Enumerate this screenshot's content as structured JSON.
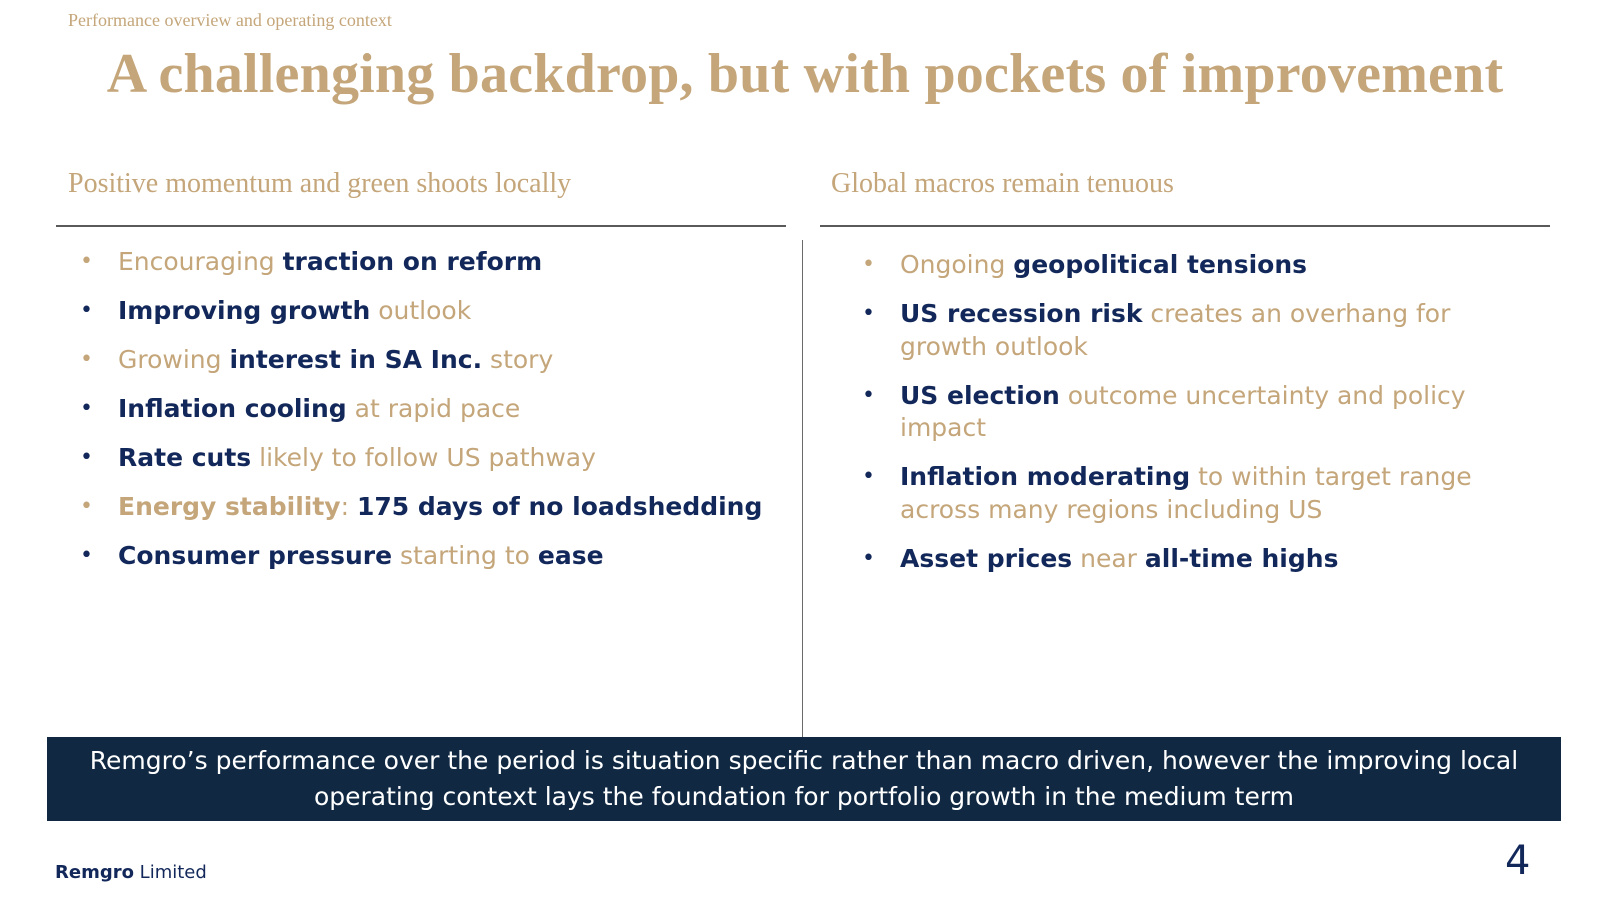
{
  "header": {
    "section_tag": "Performance overview and operating context",
    "title": "A challenging backdrop, but with pockets of improvement"
  },
  "colors": {
    "gold": "#C4A67A",
    "navy": "#13285A",
    "banner_bg": "#102842",
    "banner_text": "#FFFFFF"
  },
  "left_column": {
    "heading": "Positive momentum and green shoots locally",
    "items": [
      {
        "bullet_color": "gold",
        "segments": [
          {
            "text": "Encouraging ",
            "style": "light-gold"
          },
          {
            "text": "traction on reform",
            "style": "bold-navy"
          }
        ]
      },
      {
        "bullet_color": "navy",
        "segments": [
          {
            "text": "Improving growth",
            "style": "bold-navy"
          },
          {
            "text": " outlook",
            "style": "light-gold"
          }
        ]
      },
      {
        "bullet_color": "gold",
        "segments": [
          {
            "text": "Growing ",
            "style": "light-gold"
          },
          {
            "text": "interest in SA Inc.",
            "style": "bold-navy"
          },
          {
            "text": " story",
            "style": "light-gold"
          }
        ]
      },
      {
        "bullet_color": "navy",
        "segments": [
          {
            "text": "Inflation cooling",
            "style": "bold-navy"
          },
          {
            "text": " at rapid pace",
            "style": "light-gold"
          }
        ]
      },
      {
        "bullet_color": "navy",
        "segments": [
          {
            "text": "Rate cuts",
            "style": "bold-navy"
          },
          {
            "text": " likely to follow US pathway",
            "style": "light-gold"
          }
        ]
      },
      {
        "bullet_color": "gold",
        "segments": [
          {
            "text": "Energy stability",
            "style": "bold-gold"
          },
          {
            "text": ": ",
            "style": "light-gold"
          },
          {
            "text": "175 days of no loadshedding",
            "style": "bold-navy"
          }
        ]
      },
      {
        "bullet_color": "navy",
        "segments": [
          {
            "text": "Consumer pressure",
            "style": "bold-navy"
          },
          {
            "text": " starting to ",
            "style": "light-gold"
          },
          {
            "text": "ease",
            "style": "bold-navy"
          }
        ]
      }
    ]
  },
  "right_column": {
    "heading": "Global macros remain tenuous",
    "items": [
      {
        "bullet_color": "gold",
        "segments": [
          {
            "text": "Ongoing ",
            "style": "light-gold"
          },
          {
            "text": "geopolitical tensions",
            "style": "bold-navy"
          }
        ]
      },
      {
        "bullet_color": "navy",
        "segments": [
          {
            "text": "US recession risk",
            "style": "bold-navy"
          },
          {
            "text": " creates an overhang for growth outlook",
            "style": "light-gold"
          }
        ]
      },
      {
        "bullet_color": "navy",
        "segments": [
          {
            "text": "US election",
            "style": "bold-navy"
          },
          {
            "text": " outcome uncertainty and policy impact",
            "style": "light-gold"
          }
        ]
      },
      {
        "bullet_color": "navy",
        "segments": [
          {
            "text": "Inflation moderating",
            "style": "bold-navy"
          },
          {
            "text": " to within target range across many regions including US",
            "style": "light-gold"
          }
        ]
      },
      {
        "bullet_color": "navy",
        "segments": [
          {
            "text": "Asset prices",
            "style": "bold-navy"
          },
          {
            "text": " near ",
            "style": "light-gold"
          },
          {
            "text": "all-time highs",
            "style": "bold-navy"
          }
        ]
      }
    ]
  },
  "banner": {
    "text": "Remgro’s performance over the period is situation specific rather than macro driven, however the improving local operating context lays the foundation for portfolio growth in the medium term"
  },
  "footer": {
    "brand_strong": "Remgro",
    "brand_rest": " Limited",
    "page_number": "4"
  }
}
